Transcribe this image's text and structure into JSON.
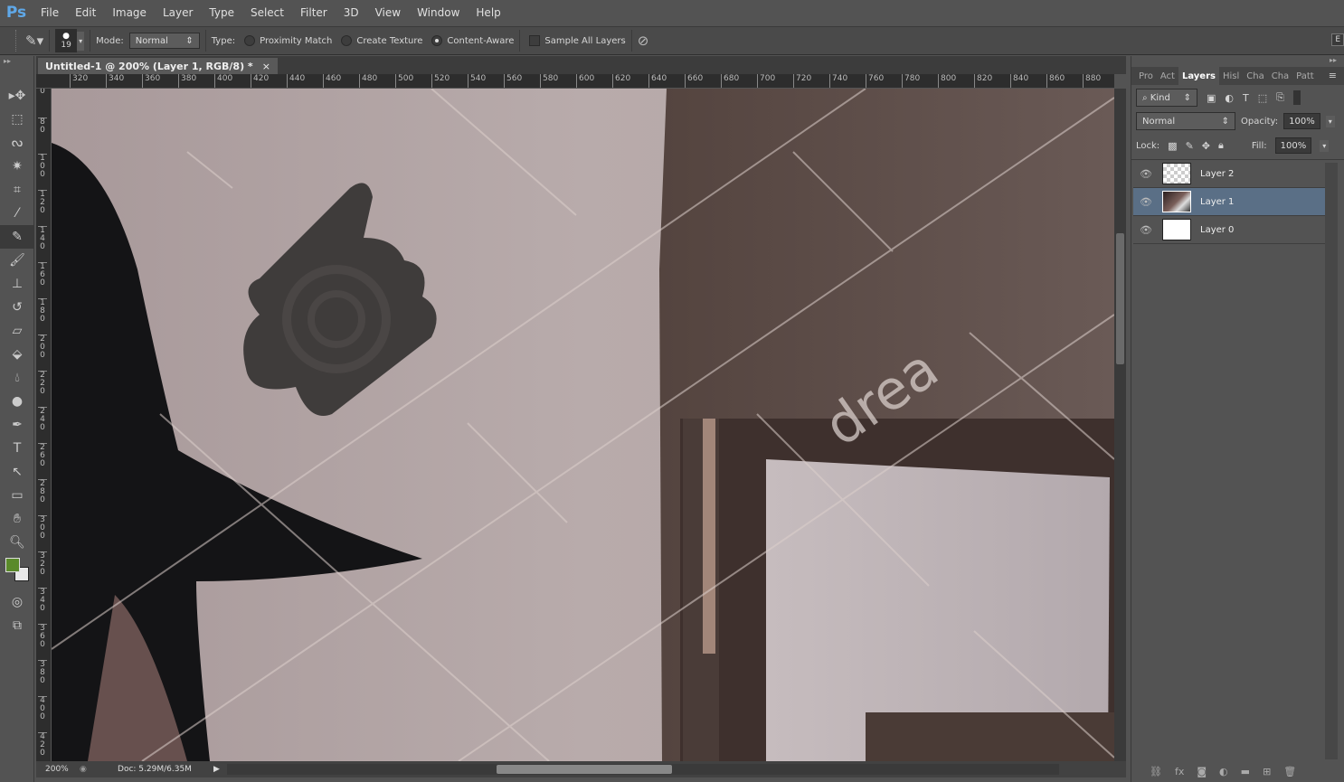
{
  "app": {
    "logo": "Ps"
  },
  "menu": [
    "File",
    "Edit",
    "Image",
    "Layer",
    "Type",
    "Select",
    "Filter",
    "3D",
    "View",
    "Window",
    "Help"
  ],
  "options": {
    "brush_size": "19",
    "mode_label": "Mode:",
    "mode_value": "Normal",
    "type_label": "Type:",
    "type_options": [
      {
        "label": "Proximity Match",
        "selected": false
      },
      {
        "label": "Create Texture",
        "selected": false
      },
      {
        "label": "Content-Aware",
        "selected": true
      }
    ],
    "sample_all_layers": {
      "label": "Sample All Layers",
      "checked": false
    },
    "right_button": "E"
  },
  "document": {
    "tab_title": "Untitled-1 @ 200% (Layer 1, RGB/8) *",
    "close": "×"
  },
  "rulers": {
    "horizontal": [
      "320",
      "340",
      "360",
      "380",
      "400",
      "420",
      "440",
      "460",
      "480",
      "500",
      "520",
      "540",
      "560",
      "580",
      "600",
      "620",
      "640",
      "660",
      "680",
      "700",
      "720",
      "740",
      "760",
      "780",
      "800",
      "820",
      "840",
      "860",
      "880"
    ],
    "vertical": [
      "0",
      "80",
      "100",
      "120",
      "140",
      "160",
      "180",
      "200",
      "220",
      "240",
      "260",
      "280",
      "300",
      "320",
      "340",
      "360",
      "380",
      "400",
      "420"
    ]
  },
  "canvas": {
    "watermark": "drea"
  },
  "status": {
    "zoom": "200%",
    "doc": "Doc: 5.29M/6.35M"
  },
  "panel": {
    "tabs": [
      {
        "label": "Pro",
        "active": false
      },
      {
        "label": "Act",
        "active": false
      },
      {
        "label": "Layers",
        "active": true
      },
      {
        "label": "Hisl",
        "active": false
      },
      {
        "label": "Cha",
        "active": false
      },
      {
        "label": "Cha",
        "active": false
      },
      {
        "label": "Patt",
        "active": false
      }
    ],
    "filter": "Kind",
    "blend_mode": "Normal",
    "opacity_label": "Opacity:",
    "opacity": "100%",
    "lock_label": "Lock:",
    "fill_label": "Fill:",
    "fill": "100%",
    "layers": [
      {
        "name": "Layer 2",
        "visible": true,
        "selected": false,
        "thumb": "transparent"
      },
      {
        "name": "Layer 1",
        "visible": true,
        "selected": true,
        "thumb": "photo"
      },
      {
        "name": "Layer 0",
        "visible": true,
        "selected": false,
        "thumb": "white"
      }
    ]
  },
  "colors": {
    "foreground": "#5a8a2a",
    "background": "#e8e8e8",
    "selected_layer": "#5a6f86"
  }
}
